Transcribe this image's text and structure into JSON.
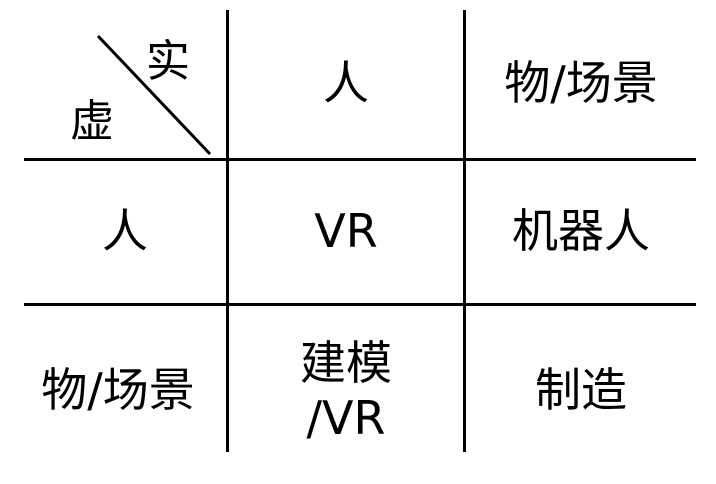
{
  "corner": {
    "top_label": "实",
    "bottom_label": "虚"
  },
  "header": {
    "col1": "人",
    "col2": "物/场景"
  },
  "rows": [
    {
      "header": "人",
      "col1": "VR",
      "col2": "机器人"
    },
    {
      "header": "物/场景",
      "col1_line1": "建模",
      "col1_line2": "/VR",
      "col2": "制造"
    }
  ]
}
